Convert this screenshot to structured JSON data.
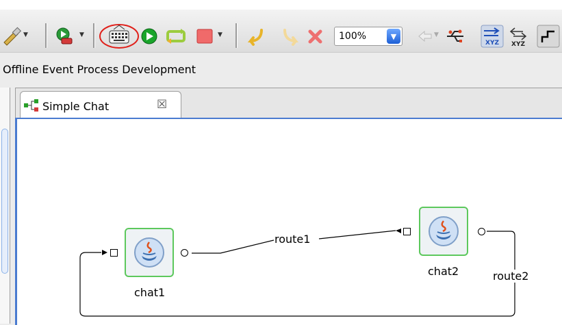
{
  "toolbar": {
    "zoom_value": "100%",
    "highlight_color": "#e0201a",
    "icons": [
      "brush-icon",
      "run-config-icon",
      "keyboard-icon",
      "play-icon",
      "refresh-icon",
      "stop-icon",
      "undo-icon",
      "redo-icon",
      "delete-icon",
      "back-icon",
      "usb-icon",
      "xyz-layout-icon",
      "xyz-icon",
      "step-icon"
    ]
  },
  "breadcrumb": "Offline Event Process Development",
  "editor_tab": {
    "label": "Simple Chat",
    "close_glyph": "☒"
  },
  "diagram": {
    "nodes": [
      {
        "id": "chat1",
        "label": "chat1"
      },
      {
        "id": "chat2",
        "label": "chat2"
      }
    ],
    "routes": [
      {
        "label": "route1"
      },
      {
        "label": "route2"
      }
    ],
    "node_border_color": "#5cc85c"
  }
}
